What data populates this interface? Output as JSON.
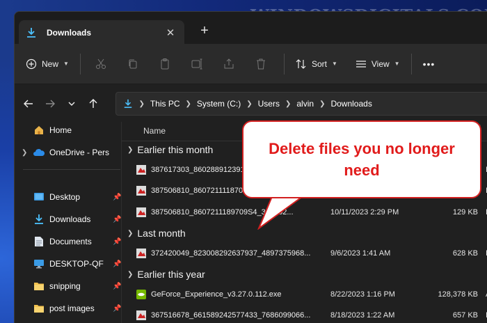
{
  "watermark": {
    "text": "WindowsDigitals.com"
  },
  "colors": {
    "accent": "#4cc2ff",
    "callout_text": "#e11b1b",
    "callout_border": "#d21f1f",
    "window_bg": "#202020"
  },
  "tab": {
    "title": "Downloads",
    "icon": "download-icon",
    "close": "✕",
    "new_tab": "+"
  },
  "command_bar": {
    "new_label": "New",
    "sort_label": "Sort",
    "view_label": "View",
    "more": "•••",
    "tools": [
      "cut-icon",
      "copy-icon",
      "paste-icon",
      "rename-icon",
      "share-icon",
      "delete-icon"
    ]
  },
  "address": {
    "crumbs": [
      "This PC",
      "System (C:)",
      "Users",
      "alvin",
      "Downloads"
    ]
  },
  "sidebar": {
    "items": [
      {
        "label": "Home",
        "icon": "home-icon",
        "pinned": false,
        "chevron": false
      },
      {
        "label": "OneDrive - Pers",
        "icon": "cloud-icon",
        "pinned": false,
        "chevron": true
      },
      {
        "label": "Desktop",
        "icon": "desktop-icon",
        "pinned": true,
        "chevron": false
      },
      {
        "label": "Downloads",
        "icon": "download-icon",
        "pinned": true,
        "chevron": false
      },
      {
        "label": "Documents",
        "icon": "document-icon",
        "pinned": true,
        "chevron": false
      },
      {
        "label": "DESKTOP-QF",
        "icon": "monitor-icon",
        "pinned": true,
        "chevron": false
      },
      {
        "label": "snipping",
        "icon": "folder-icon",
        "pinned": true,
        "chevron": false
      },
      {
        "label": "post images",
        "icon": "folder-icon",
        "pinned": true,
        "chevron": false
      }
    ]
  },
  "columns": {
    "name": "Name"
  },
  "groups": [
    {
      "label": "Earlier this month",
      "files": [
        {
          "name": "387617303_8602889123919",
          "date": "",
          "size": "",
          "type": "Irfan"
        },
        {
          "name": "387506810_8607211118709",
          "date": "",
          "size": "",
          "type": "Irfan"
        },
        {
          "name": "387506810_8607211189709S4_374362...",
          "date": "10/11/2023 2:29 PM",
          "size": "129 KB",
          "type": "Irfan"
        }
      ]
    },
    {
      "label": "Last month",
      "files": [
        {
          "name": "372420049_823008292637937_4897375968...",
          "date": "9/6/2023 1:41 AM",
          "size": "628 KB",
          "type": "Irfan"
        }
      ]
    },
    {
      "label": "Earlier this year",
      "files": [
        {
          "name": "GeForce_Experience_v3.27.0.112.exe",
          "date": "8/22/2023 1:16 PM",
          "size": "128,378 KB",
          "type": "Appl"
        },
        {
          "name": "367516678_661589242577433_7686099066...",
          "date": "8/18/2023 1:22 AM",
          "size": "657 KB",
          "type": "Irfan"
        }
      ]
    }
  ],
  "callout": {
    "text": "Delete files you no longer need"
  }
}
